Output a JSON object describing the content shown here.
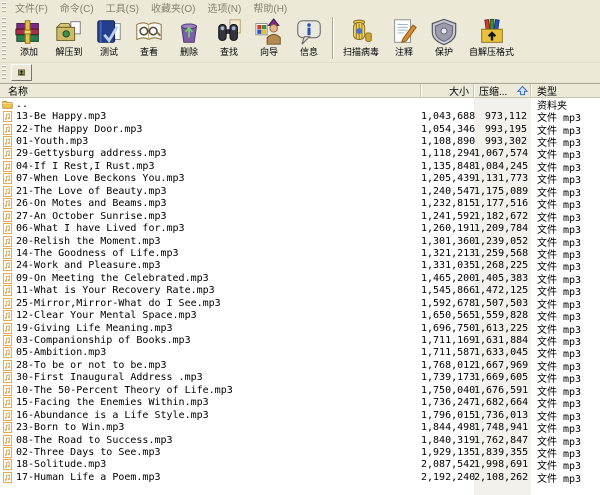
{
  "menu": {
    "items": [
      {
        "label": "文件(F)"
      },
      {
        "label": "命令(C)"
      },
      {
        "label": "工具(S)"
      },
      {
        "label": "收藏夹(O)"
      },
      {
        "label": "选项(N)"
      },
      {
        "label": "帮助(H)"
      }
    ]
  },
  "toolbar": {
    "buttons": [
      {
        "icon": "add",
        "label": "添加"
      },
      {
        "icon": "extract",
        "label": "解压到"
      },
      {
        "icon": "test",
        "label": "测试"
      },
      {
        "icon": "view",
        "label": "查看"
      },
      {
        "icon": "delete",
        "label": "删除"
      },
      {
        "icon": "find",
        "label": "查找"
      },
      {
        "icon": "wizard",
        "label": "向导"
      },
      {
        "icon": "info",
        "label": "信息"
      },
      {
        "type": "sep"
      },
      {
        "icon": "scan",
        "label": "扫描病毒"
      },
      {
        "icon": "comment",
        "label": "注释"
      },
      {
        "icon": "protect",
        "label": "保护"
      },
      {
        "icon": "sfx",
        "label": "自解压格式"
      }
    ]
  },
  "addressbar": {
    "up_button": "folder-up"
  },
  "list": {
    "columns": {
      "name": "名称",
      "size": "大小",
      "packed": "压缩...",
      "type": "类型"
    },
    "sort": {
      "column": "packed",
      "direction": "ascending"
    },
    "rows": [
      {
        "icon": "folder",
        "name": "..",
        "size": "",
        "packed": "",
        "type": "资料夹"
      },
      {
        "icon": "mp3",
        "name": "13-Be Happy.mp3",
        "size": "1,043,688",
        "packed": "973,112",
        "type": "文件 mp3"
      },
      {
        "icon": "mp3",
        "name": "22-The Happy Door.mp3",
        "size": "1,054,346",
        "packed": "993,195",
        "type": "文件 mp3"
      },
      {
        "icon": "mp3",
        "name": "01-Youth.mp3",
        "size": "1,108,890",
        "packed": "993,302",
        "type": "文件 mp3"
      },
      {
        "icon": "mp3",
        "name": "29-Gettysburg address.mp3",
        "size": "1,118,294",
        "packed": "1,067,574",
        "type": "文件 mp3"
      },
      {
        "icon": "mp3",
        "name": "04-If I Rest,I Rust.mp3",
        "size": "1,135,848",
        "packed": "1,084,245",
        "type": "文件 mp3"
      },
      {
        "icon": "mp3",
        "name": "07-When Love Beckons You.mp3",
        "size": "1,205,439",
        "packed": "1,131,773",
        "type": "文件 mp3"
      },
      {
        "icon": "mp3",
        "name": "21-The Love of Beauty.mp3",
        "size": "1,240,547",
        "packed": "1,175,089",
        "type": "文件 mp3"
      },
      {
        "icon": "mp3",
        "name": "26-On Motes and Beams.mp3",
        "size": "1,232,815",
        "packed": "1,177,516",
        "type": "文件 mp3"
      },
      {
        "icon": "mp3",
        "name": "27-An October Sunrise.mp3",
        "size": "1,241,592",
        "packed": "1,182,672",
        "type": "文件 mp3"
      },
      {
        "icon": "mp3",
        "name": "06-What I have Lived for.mp3",
        "size": "1,260,191",
        "packed": "1,209,784",
        "type": "文件 mp3"
      },
      {
        "icon": "mp3",
        "name": "20-Relish the Moment.mp3",
        "size": "1,301,360",
        "packed": "1,239,052",
        "type": "文件 mp3"
      },
      {
        "icon": "mp3",
        "name": "14-The Goodness of Life.mp3",
        "size": "1,321,213",
        "packed": "1,259,568",
        "type": "文件 mp3"
      },
      {
        "icon": "mp3",
        "name": "24-Work and Pleasure.mp3",
        "size": "1,331,035",
        "packed": "1,268,225",
        "type": "文件 mp3"
      },
      {
        "icon": "mp3",
        "name": "09-On Meeting the Celebrated.mp3",
        "size": "1,465,200",
        "packed": "1,405,383",
        "type": "文件 mp3"
      },
      {
        "icon": "mp3",
        "name": "11-What is Your Recovery Rate.mp3",
        "size": "1,545,866",
        "packed": "1,472,125",
        "type": "文件 mp3"
      },
      {
        "icon": "mp3",
        "name": "25-Mirror,Mirror-What do I See.mp3",
        "size": "1,592,678",
        "packed": "1,507,503",
        "type": "文件 mp3"
      },
      {
        "icon": "mp3",
        "name": "12-Clear Your Mental Space.mp3",
        "size": "1,650,565",
        "packed": "1,559,828",
        "type": "文件 mp3"
      },
      {
        "icon": "mp3",
        "name": "19-Giving Life Meaning.mp3",
        "size": "1,696,750",
        "packed": "1,613,225",
        "type": "文件 mp3"
      },
      {
        "icon": "mp3",
        "name": "03-Companionship of Books.mp3",
        "size": "1,711,169",
        "packed": "1,631,884",
        "type": "文件 mp3"
      },
      {
        "icon": "mp3",
        "name": "05-Ambition.mp3",
        "size": "1,711,587",
        "packed": "1,633,045",
        "type": "文件 mp3"
      },
      {
        "icon": "mp3",
        "name": "28-To be or not to be.mp3",
        "size": "1,768,012",
        "packed": "1,667,969",
        "type": "文件 mp3"
      },
      {
        "icon": "mp3",
        "name": "30-First Inaugural Address .mp3",
        "size": "1,739,173",
        "packed": "1,669,605",
        "type": "文件 mp3"
      },
      {
        "icon": "mp3",
        "name": "10-The 50-Percent Theory of Life.mp3",
        "size": "1,750,040",
        "packed": "1,676,591",
        "type": "文件 mp3"
      },
      {
        "icon": "mp3",
        "name": "15-Facing the Enemies Within.mp3",
        "size": "1,736,247",
        "packed": "1,682,664",
        "type": "文件 mp3"
      },
      {
        "icon": "mp3",
        "name": "16-Abundance is a Life Style.mp3",
        "size": "1,796,015",
        "packed": "1,736,013",
        "type": "文件 mp3"
      },
      {
        "icon": "mp3",
        "name": "23-Born to Win.mp3",
        "size": "1,844,498",
        "packed": "1,748,941",
        "type": "文件 mp3"
      },
      {
        "icon": "mp3",
        "name": "08-The Road to Success.mp3",
        "size": "1,840,319",
        "packed": "1,762,847",
        "type": "文件 mp3"
      },
      {
        "icon": "mp3",
        "name": "02-Three Days to See.mp3",
        "size": "1,929,135",
        "packed": "1,839,355",
        "type": "文件 mp3"
      },
      {
        "icon": "mp3",
        "name": "18-Solitude.mp3",
        "size": "2,087,542",
        "packed": "1,998,691",
        "type": "文件 mp3"
      },
      {
        "icon": "mp3",
        "name": "17-Human Life a Poem.mp3",
        "size": "2,192,240",
        "packed": "2,108,262",
        "type": "文件 mp3"
      }
    ]
  },
  "colors": {
    "chrome": "#ece9d8",
    "sort_band": "#f2f1ec",
    "sort_arrow_blue": "#3a6fc4",
    "mp3_icon_orange": "#e09a2b"
  }
}
